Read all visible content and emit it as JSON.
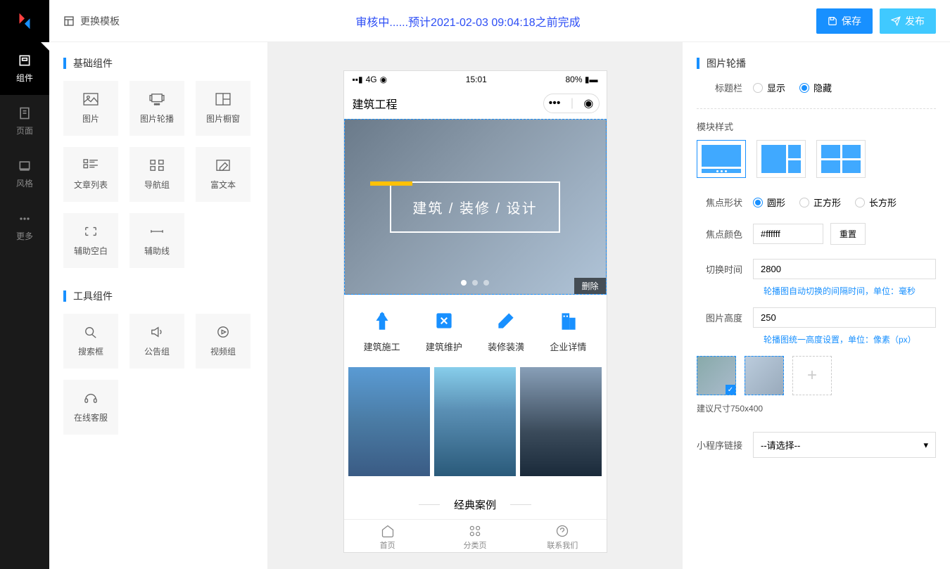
{
  "header": {
    "switch_template": "更换模板",
    "status": "审核中......预计2021-02-03 09:04:18之前完成",
    "save": "保存",
    "publish": "发布"
  },
  "nav": {
    "components": "组件",
    "pages": "页面",
    "style": "风格",
    "more": "更多"
  },
  "sections": {
    "basic": "基础组件",
    "tools": "工具组件"
  },
  "components": {
    "image": "图片",
    "carousel": "图片轮播",
    "window": "图片橱窗",
    "article_list": "文章列表",
    "nav_group": "导航组",
    "rich_text": "富文本",
    "blank": "辅助空白",
    "line": "辅助线",
    "search": "搜索框",
    "notice": "公告组",
    "video": "视频组",
    "service": "在线客服"
  },
  "phone": {
    "signal": "4G",
    "time": "15:01",
    "battery": "80%",
    "title": "建筑工程",
    "banner_text": "建筑 / 装修 / 设计",
    "delete": "删除",
    "nav_items": [
      "建筑施工",
      "建筑维护",
      "装修装潢",
      "企业详情"
    ],
    "section": "经典案例",
    "tabs": [
      "首页",
      "分类页",
      "联系我们"
    ]
  },
  "props": {
    "panel_title": "图片轮播",
    "title_bar": "标题栏",
    "show": "显示",
    "hide": "隐藏",
    "module_style": "模块样式",
    "dot_shape": "焦点形状",
    "circle": "圆形",
    "square": "正方形",
    "rect": "长方形",
    "dot_color": "焦点颜色",
    "color_value": "#ffffff",
    "reset": "重置",
    "switch_time": "切换时间",
    "switch_time_value": "2800",
    "switch_time_hint": "轮播图自动切换的间隔时间，单位：毫秒",
    "img_height": "图片高度",
    "img_height_value": "250",
    "img_height_hint": "轮播图统一高度设置，单位：像素（px）",
    "rec_size": "建议尺寸750x400",
    "link_label": "小程序链接",
    "link_placeholder": "--请选择--"
  }
}
